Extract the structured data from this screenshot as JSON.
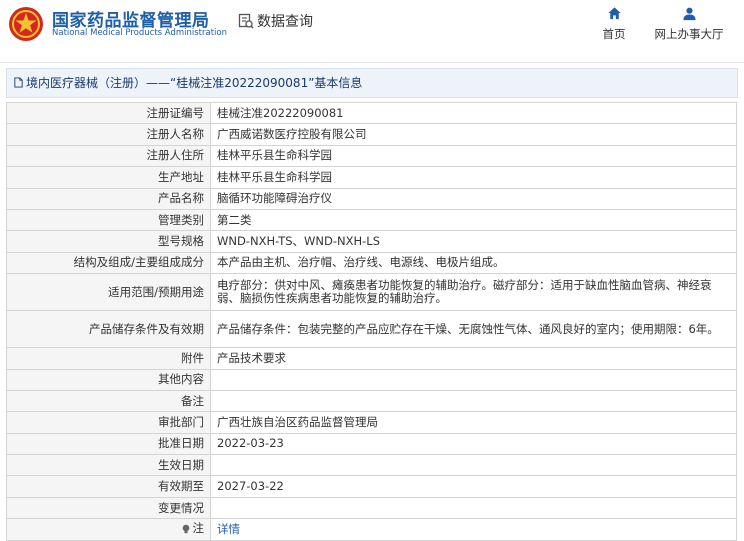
{
  "header": {
    "site_title": "国家药品监督管理局",
    "site_subtitle": "National Medical Products Administration",
    "data_query": "数据查询",
    "nav_home": "首页",
    "nav_hall": "网上办事大厅"
  },
  "breadcrumb": {
    "text": "境内医疗器械（注册）——“桂械注准20222090081”基本信息"
  },
  "details": {
    "rows": [
      {
        "label": "注册证编号",
        "value": "桂械注准20222090081"
      },
      {
        "label": "注册人名称",
        "value": "广西威诺数医疗控股有限公司"
      },
      {
        "label": "注册人住所",
        "value": "桂林平乐县生命科学园"
      },
      {
        "label": "生产地址",
        "value": "桂林平乐县生命科学园"
      },
      {
        "label": "产品名称",
        "value": "脑循环功能障碍治疗仪"
      },
      {
        "label": "管理类别",
        "value": "第二类"
      },
      {
        "label": "型号规格",
        "value": "WND-NXH-TS、WND-NXH-LS"
      },
      {
        "label": "结构及组成/主要组成成分",
        "value": "本产品由主机、治疗帽、治疗线、电源线、电极片组成。"
      },
      {
        "label": "适用范围/预期用途",
        "value": "电疗部分：供对中风、瘫痪患者功能恢复的辅助治疗。磁疗部分：适用于缺血性脑血管病、神经衰弱、脑损伤性疾病患者功能恢复的辅助治疗。"
      },
      {
        "label": "产品储存条件及有效期",
        "value": "产品储存条件：包装完整的产品应贮存在干燥、无腐蚀性气体、通风良好的室内；使用期限：6年。"
      },
      {
        "label": "附件",
        "value": "产品技术要求"
      },
      {
        "label": "其他内容",
        "value": ""
      },
      {
        "label": "备注",
        "value": ""
      },
      {
        "label": "审批部门",
        "value": "广西壮族自治区药品监督管理局"
      },
      {
        "label": "批准日期",
        "value": "2022-03-23"
      },
      {
        "label": "生效日期",
        "value": ""
      },
      {
        "label": "有效期至",
        "value": "2027-03-22"
      },
      {
        "label": "变更情况",
        "value": ""
      }
    ],
    "note_label": "注",
    "note_link": "详情"
  },
  "colors": {
    "brand": "#1f5fa8",
    "logo_red": "#d7261e",
    "logo_gold": "#f2c230"
  }
}
